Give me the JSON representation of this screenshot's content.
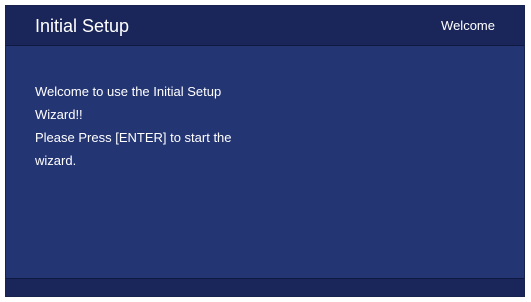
{
  "header": {
    "title": "Initial Setup",
    "screen_name": "Welcome"
  },
  "message": {
    "lines": [
      "Welcome to use the Initial Setup",
      "Wizard!!",
      "Please Press [ENTER] to start the",
      "wizard."
    ]
  },
  "colors": {
    "panel_background": "#243573",
    "header_background": "#1a2659",
    "text": "#ffffff"
  }
}
